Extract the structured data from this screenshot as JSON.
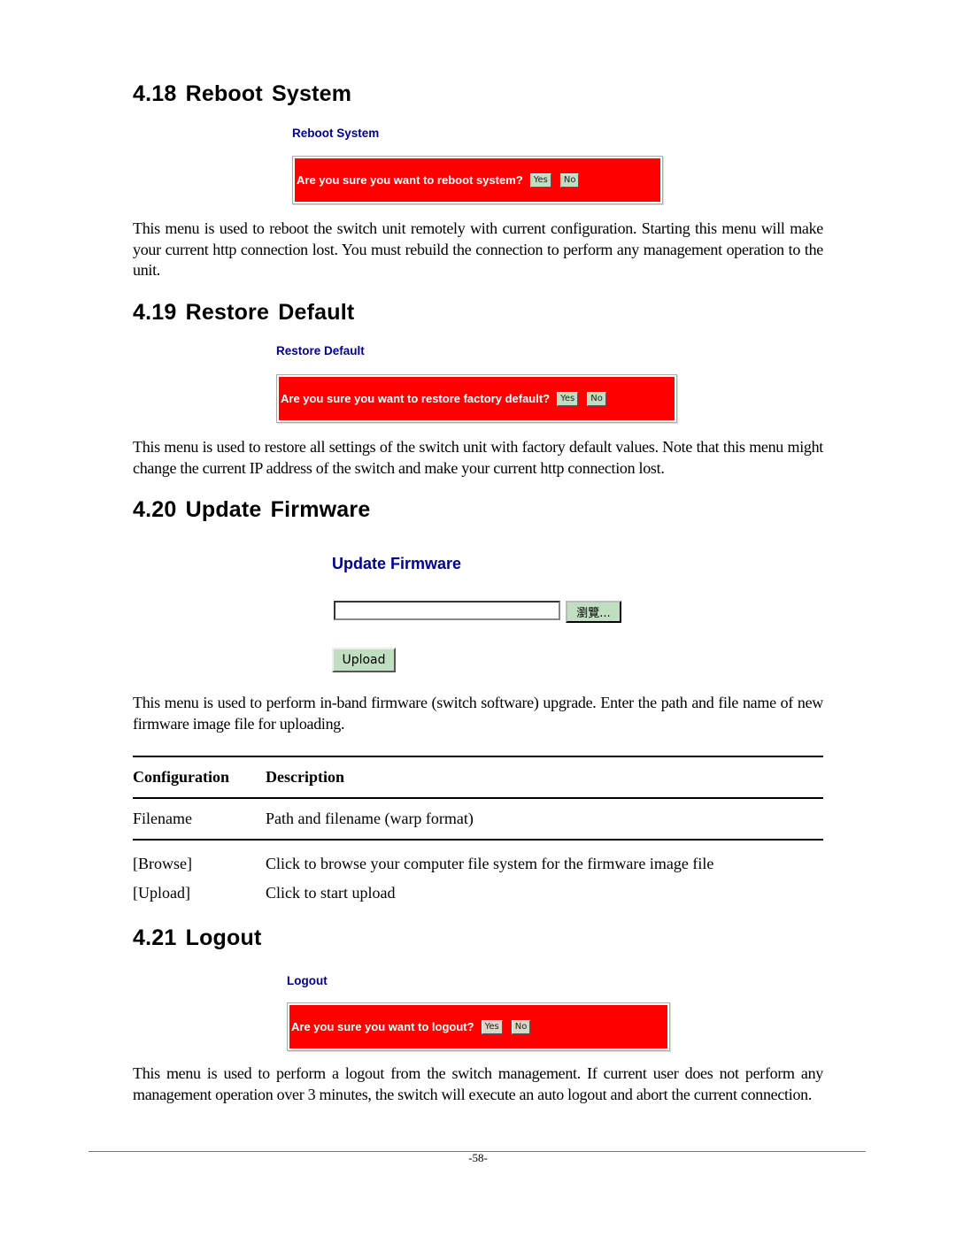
{
  "sections": [
    {
      "heading": "4.18 Reboot System",
      "ui_title": "Reboot System",
      "prompt": "Are you sure you want to reboot system?",
      "yes_label": "Yes",
      "no_label": "No",
      "description": "This menu is used to reboot the switch unit remotely with current configuration. Starting this menu will make your current http connection lost. You must rebuild the connection to perform any management operation to the unit."
    },
    {
      "heading": "4.19 Restore Default",
      "ui_title": "Restore Default",
      "prompt": "Are you sure you want to restore factory default?",
      "yes_label": "Yes",
      "no_label": "No",
      "description": "This menu is used to restore all settings of the switch unit with factory default values. Note that this menu might change the current IP address of the switch and make your current http connection lost."
    },
    {
      "heading": "4.20 Update Firmware",
      "ui_title": "Update Firmware",
      "file_input_value": "",
      "browse_label": "瀏覽...",
      "upload_label": "Upload",
      "description": "This menu is used to perform in-band firmware (switch software) upgrade. Enter the path and file name of new firmware image file for uploading."
    },
    {
      "heading": "4.21 Logout",
      "ui_title": "Logout",
      "prompt": "Are you sure you want to logout?",
      "yes_label": "Yes",
      "no_label": "No",
      "description": "This menu is used to perform a logout from the switch management. If current user does not perform any management operation over 3 minutes, the switch will execute an auto logout and abort the current connection."
    }
  ],
  "config_table": {
    "headers": [
      "Configuration",
      "Description"
    ],
    "rows": [
      [
        "Filename",
        "Path and filename (warp format)"
      ],
      [
        "[Browse]",
        "Click to browse your computer file system for the firmware image file"
      ],
      [
        "[Upload]",
        "Click to start upload"
      ]
    ]
  },
  "footer": {
    "page_number": "-58-"
  },
  "colors": {
    "alert_bg": "#ff0000",
    "ui_title": "#00008b",
    "button_green": "#c0dfc0"
  }
}
